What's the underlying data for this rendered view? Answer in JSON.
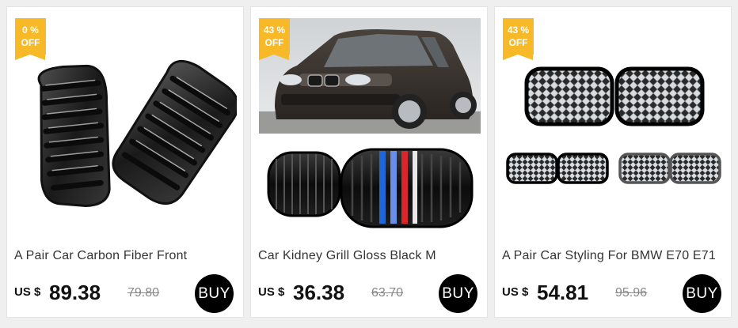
{
  "products": [
    {
      "badge": {
        "percent": "0 %",
        "off": "OFF"
      },
      "title": "A Pair Car Carbon Fiber Front",
      "currency": "US $",
      "price": "89.38",
      "old_price": "79.80",
      "buy_label": "BUY",
      "image": "carbon-fiber-kidney-grilles"
    },
    {
      "badge": {
        "percent": "43 %",
        "off": "OFF"
      },
      "title": "Car Kidney Grill Gloss Black M",
      "currency": "US $",
      "price": "36.38",
      "old_price": "63.70",
      "buy_label": "BUY",
      "image": "suv-with-m-stripe-grilles"
    },
    {
      "badge": {
        "percent": "43 %",
        "off": "OFF"
      },
      "title": "A Pair Car Styling For BMW E70 E71",
      "currency": "US $",
      "price": "54.81",
      "old_price": "95.96",
      "buy_label": "BUY",
      "image": "diamond-chrome-grilles"
    }
  ],
  "colors": {
    "badge": "#f7b928",
    "buy_button": "#000000",
    "background": "#efefef"
  }
}
